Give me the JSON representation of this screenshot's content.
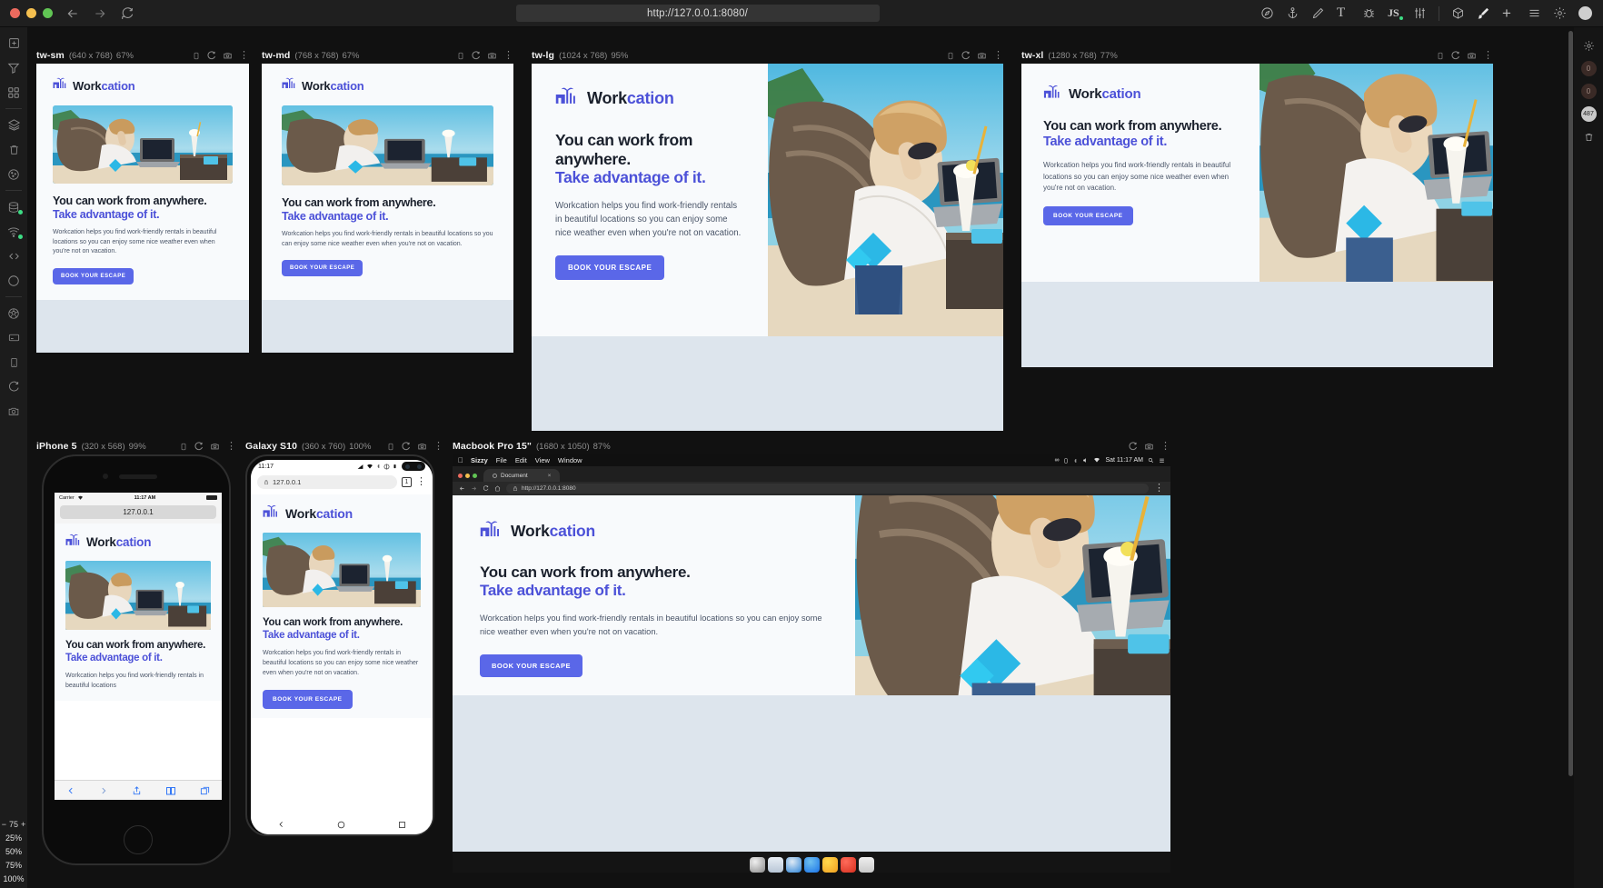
{
  "topbar": {
    "url": "http://127.0.0.1:8080/",
    "window_controls": [
      "close",
      "minimize",
      "maximize"
    ],
    "nav": [
      {
        "name": "back-icon",
        "label": "Back"
      },
      {
        "name": "forward-icon",
        "label": "Forward"
      },
      {
        "name": "reload-icon",
        "label": "Reload"
      }
    ],
    "tools": [
      {
        "name": "compass-icon",
        "label": "Explore"
      },
      {
        "name": "anchor-icon",
        "label": "Anchor"
      },
      {
        "name": "pencil-icon",
        "label": "Edit"
      },
      {
        "name": "text-icon",
        "label": "T"
      },
      {
        "name": "bug-icon",
        "label": "Debug"
      },
      {
        "name": "js-icon",
        "label": "JS"
      },
      {
        "name": "sliders-icon",
        "label": "Settings sliders"
      },
      {
        "name": "cube-icon",
        "label": "3D"
      },
      {
        "name": "brush-icon",
        "label": "Style"
      },
      {
        "name": "plus-icon",
        "label": "Add"
      },
      {
        "name": "list-icon",
        "label": "List"
      },
      {
        "name": "gear-icon",
        "label": "Preferences"
      },
      {
        "name": "record-icon",
        "label": "Record"
      }
    ]
  },
  "leftrail": {
    "items": [
      {
        "name": "add-device-icon",
        "label": "Add device"
      },
      {
        "name": "filter-icon",
        "label": "Filter"
      },
      {
        "name": "grid-icon",
        "label": "Grid layout"
      },
      {
        "name": "layers-icon",
        "label": "Layers"
      },
      {
        "name": "trash-icon",
        "label": "Delete"
      },
      {
        "name": "cookie-icon",
        "label": "Cookies"
      },
      {
        "name": "database-icon",
        "label": "Storage",
        "badge": true
      },
      {
        "name": "wifi-icon",
        "label": "Network throttle",
        "badge": true
      },
      {
        "name": "code-icon",
        "label": "Inspect code"
      },
      {
        "name": "circle-icon",
        "label": "Select"
      },
      {
        "name": "soccer-icon",
        "label": "Browser engine"
      },
      {
        "name": "card-icon",
        "label": "Card view"
      },
      {
        "name": "mobile-icon",
        "label": "Mobile view"
      },
      {
        "name": "refresh-icon",
        "label": "Refresh all"
      },
      {
        "name": "camera-icon",
        "label": "Screenshot all"
      }
    ],
    "zoom": {
      "minus": "−",
      "value": "75",
      "plus": "+",
      "presets": [
        "25%",
        "50%",
        "75%",
        "100%"
      ]
    }
  },
  "rightrail": {
    "items": [
      {
        "name": "gear-icon",
        "label": "Settings"
      },
      {
        "name": "counter-zero-a",
        "label": "0"
      },
      {
        "name": "counter-zero-b",
        "label": "0"
      },
      {
        "name": "counter-487",
        "label": "487"
      },
      {
        "name": "trash-icon",
        "label": "Clear"
      }
    ]
  },
  "devices": [
    {
      "id": "tw-sm",
      "name": "tw-sm",
      "dimensions": "(640 x 768)",
      "zoom": "67%"
    },
    {
      "id": "tw-md",
      "name": "tw-md",
      "dimensions": "(768 x 768)",
      "zoom": "67%"
    },
    {
      "id": "tw-lg",
      "name": "tw-lg",
      "dimensions": "(1024 x 768)",
      "zoom": "95%"
    },
    {
      "id": "tw-xl",
      "name": "tw-xl",
      "dimensions": "(1280 x 768)",
      "zoom": "77%"
    },
    {
      "id": "iphone5",
      "name": "iPhone 5",
      "dimensions": "(320 x 568)",
      "zoom": "99%"
    },
    {
      "id": "galaxys10",
      "name": "Galaxy S10",
      "dimensions": "(360 x 760)",
      "zoom": "100%"
    },
    {
      "id": "macbook",
      "name": "Macbook Pro 15\"",
      "dimensions": "(1680 x 1050)",
      "zoom": "87%"
    }
  ],
  "device_toolbar_icons": [
    {
      "name": "device-rotate-icon",
      "label": "Rotate"
    },
    {
      "name": "device-reload-icon",
      "label": "Reload"
    },
    {
      "name": "device-screenshot-icon",
      "label": "Screenshot"
    },
    {
      "name": "device-menu-icon",
      "label": "More"
    }
  ],
  "site": {
    "logo_bold": "Work",
    "logo_accent": "cation",
    "headline_line1": "You can work from anywhere.",
    "headline_accent": "Take advantage of it.",
    "headline_sm_l1": "You can work from",
    "headline_sm_l2": "anywhere.",
    "body": "Workcation helps you find work-friendly rentals in beautiful locations so you can enjoy some nice weather even when you're not on vacation.",
    "body_truncated": "Workcation helps you find work-friendly rentals in beautiful locations",
    "cta": "BOOK YOUR ESCAPE",
    "colors": {
      "accent": "#4c51d8",
      "button": "#5a67e8",
      "heading": "#1a202c",
      "body_text": "#4a5568",
      "page_bg": "#f8fafc",
      "page_footer_bg": "#dde5ed"
    }
  },
  "iphone_chrome": {
    "carrier": "Carrier",
    "time": "11:17 AM",
    "url": "127.0.0.1",
    "toolbar_icons": [
      "back-icon",
      "forward-icon",
      "share-icon",
      "bookmarks-icon",
      "tabs-icon"
    ]
  },
  "galaxy_chrome": {
    "time": "11:17",
    "url": "127.0.0.1",
    "tab_count": "1",
    "status_icons": [
      "signal-icon",
      "wifi-icon",
      "bluetooth-icon",
      "dnd-icon",
      "battery-icon"
    ],
    "nav_icons": [
      "back-icon",
      "home-icon",
      "recents-icon"
    ]
  },
  "macbook_chrome": {
    "menu": [
      "Sizzy",
      "File",
      "Edit",
      "View",
      "Window"
    ],
    "apple_logo": "",
    "menu_right_time": "Sat 11:17 AM",
    "menu_right_icons": [
      "infinity-icon",
      "battery-icon",
      "bluetooth-icon",
      "volume-icon",
      "wifi-icon",
      "search-icon",
      "control-center-icon"
    ],
    "tab_title": "Document",
    "url": "http://127.0.0.1:8080",
    "toolbar_icons": [
      "back-icon",
      "forward-icon",
      "reload-icon",
      "home-icon",
      "lock-icon",
      "menu-icon"
    ]
  }
}
